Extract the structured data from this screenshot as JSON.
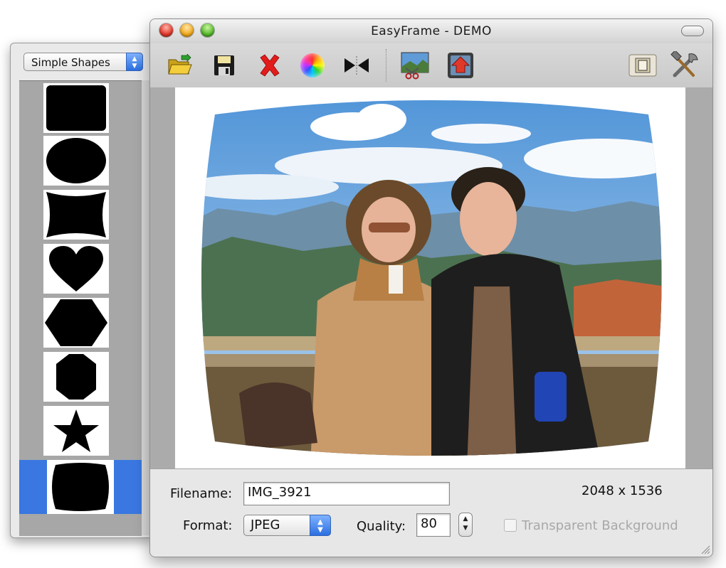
{
  "palette": {
    "category": "Simple Shapes",
    "shapes": [
      "rounded-rectangle",
      "ellipse",
      "pinched-rectangle",
      "heart",
      "hexagon",
      "octagon",
      "star",
      "bulged-rectangle"
    ],
    "selected": "bulged-rectangle"
  },
  "window": {
    "title": "EasyFrame - DEMO"
  },
  "toolbar": {
    "tools": [
      "open-folder-icon",
      "save-disk-icon",
      "delete-x-icon",
      "color-wheel-icon",
      "flip-icon",
      "crop-photo-icon",
      "export-icon",
      "frame-icon",
      "tools-icon"
    ]
  },
  "photo": {
    "description_icon": "photo-image"
  },
  "panel": {
    "filename_label": "Filename:",
    "filename_value": "IMG_3921",
    "dimensions": "2048 x 1536",
    "format_label": "Format:",
    "format_value": "JPEG",
    "quality_label": "Quality:",
    "quality_value": "80",
    "transparent_label": "Transparent Background",
    "transparent_checked": false
  },
  "colors": {
    "selection": "#3a77e0",
    "accent_blue": "#2b6fe0"
  }
}
